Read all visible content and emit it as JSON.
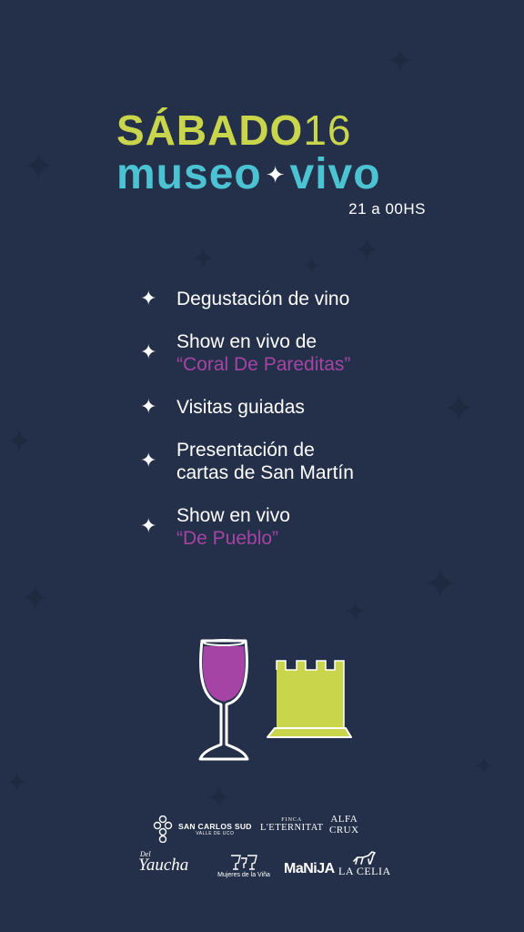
{
  "colors": {
    "background": "#243049",
    "lime": "#c9d64c",
    "cyan": "#4cc3d3",
    "magenta": "#a544a4",
    "text": "#ffffff"
  },
  "header": {
    "day_name": "SÁBADO",
    "day_number": "16",
    "event_part1": "museo",
    "event_part2": "vivo",
    "hours": "21 a 00HS"
  },
  "activities": [
    {
      "icon": "sparkle-icon",
      "lines": [
        "Degustación de vino"
      ],
      "highlight": ""
    },
    {
      "icon": "sparkle-icon",
      "lines": [
        "Show en vivo de"
      ],
      "highlight": "“Coral De Pareditas”"
    },
    {
      "icon": "sparkle-icon",
      "lines": [
        "Visitas guiadas"
      ],
      "highlight": ""
    },
    {
      "icon": "sparkle-icon",
      "lines": [
        "Presentación de",
        "cartas de San Martín"
      ],
      "highlight": ""
    },
    {
      "icon": "sparkle-icon",
      "lines": [
        "Show en vivo"
      ],
      "highlight": "“De Pueblo”"
    }
  ],
  "illustration": {
    "wine_glass": "wine-glass-icon",
    "tower": "tower-icon"
  },
  "sponsors": {
    "san_carlos": {
      "name": "SAN CARLOS SUD",
      "sub": "VALLE DE UCO"
    },
    "eternitat": {
      "finca": "FINCA",
      "name": "L'ETERNITAT"
    },
    "alfa_crux": {
      "line1": "ALFA",
      "line2": "CRUX"
    },
    "yaucha": {
      "prefix": "Del",
      "name": "Yaucha"
    },
    "mujeres": {
      "name": "Mujeres de la Viña"
    },
    "manija": {
      "name": "MaNiJA"
    },
    "la_celia": {
      "name": "LA CELIA"
    }
  }
}
